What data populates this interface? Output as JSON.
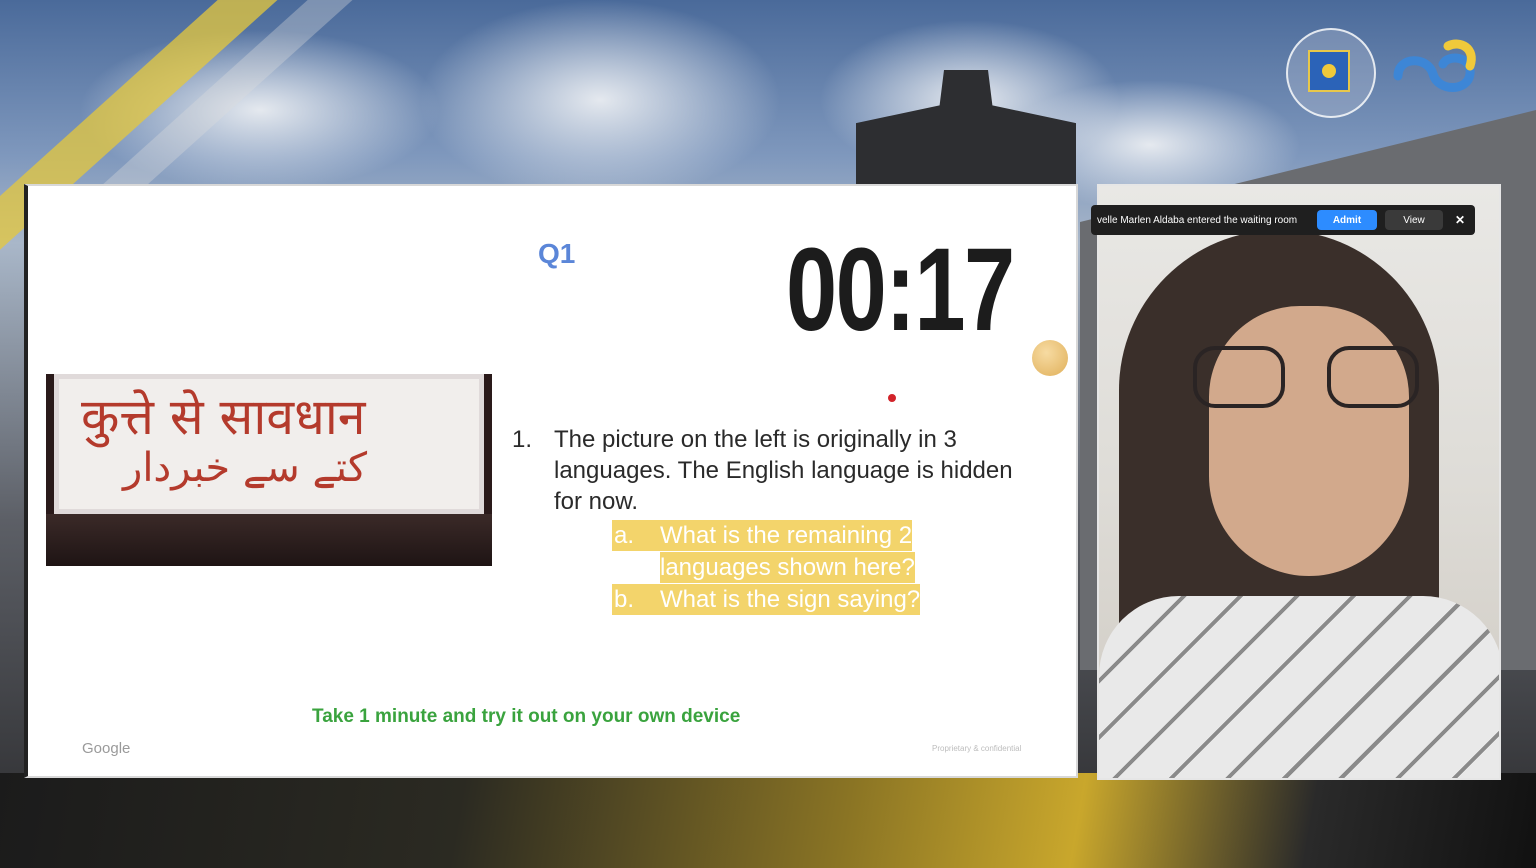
{
  "slide": {
    "question_label": "Q1",
    "timer": "00:17",
    "sign_hindi": "कुत्ते से सावधान",
    "sign_urdu": "کتے سے خبردار",
    "question_number": "1.",
    "question_text": "The picture on the left is originally in 3 languages. The English language is hidden for now.",
    "sub_a_letter": "a.",
    "sub_a_text_line1": "What is the remaining 2",
    "sub_a_text_line2": "languages shown here?",
    "sub_b_letter": "b.",
    "sub_b_text": "What is the sign saying?",
    "call_to_action": "Take 1 minute and try it out on your own device",
    "footer_logo": "Google",
    "footer_note": "Proprietary & confidential"
  },
  "notification": {
    "text": "velle Marlen Aldaba entered the waiting room",
    "admit_label": "Admit",
    "view_label": "View",
    "close_label": "✕"
  },
  "colors": {
    "accent_blue": "#2d8cff",
    "cta_green": "#3aa33e",
    "highlight_yellow": "#f3d46b",
    "q_label_blue": "#5b86d8"
  }
}
